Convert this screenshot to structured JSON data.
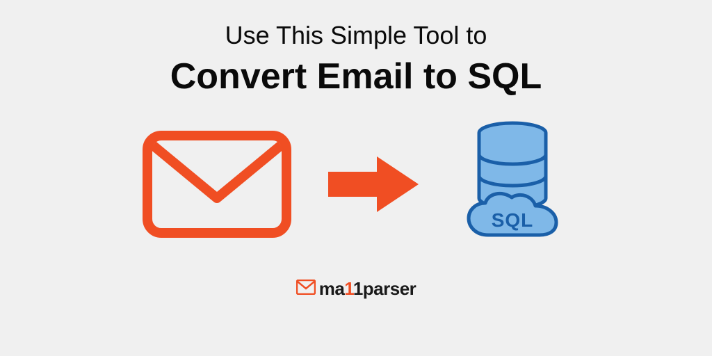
{
  "header": {
    "subtitle": "Use This Simple Tool to",
    "title": "Convert Email to SQL"
  },
  "icons": {
    "envelope": "envelope-icon",
    "arrow": "arrow-right-icon",
    "database": "sql-database-icon"
  },
  "logo": {
    "brand_prefix": "ma",
    "brand_accent": "1",
    "brand_mid": "1",
    "brand_suffix": "parser"
  },
  "colors": {
    "orange": "#f04e23",
    "blue_dark": "#1a5fa8",
    "blue_light": "#7fb8e8",
    "text": "#0a0a0a",
    "background": "#f0f0f0"
  }
}
